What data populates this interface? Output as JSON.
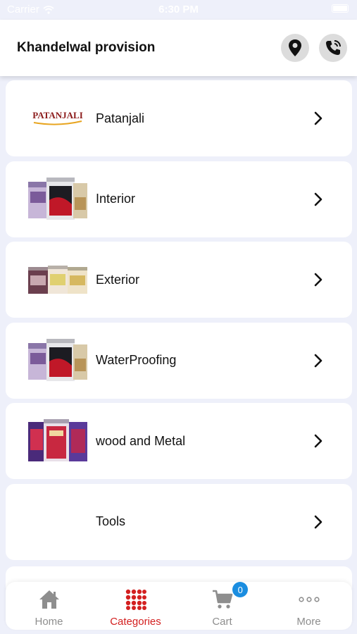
{
  "status_bar": {
    "carrier": "Carrier",
    "time": "6:30 PM"
  },
  "header": {
    "title": "Khandelwal provision",
    "icons": [
      "location-pin-icon",
      "phone-call-icon"
    ]
  },
  "categories": [
    {
      "label": "Patanjali",
      "image": "patanjali-logo",
      "brand_text": "PATANJALI"
    },
    {
      "label": "Interior",
      "image": "interior-paint-cans"
    },
    {
      "label": "Exterior",
      "image": "exterior-paint-cans"
    },
    {
      "label": "WaterProofing",
      "image": "waterproofing-paint-cans"
    },
    {
      "label": "wood and Metal",
      "image": "wood-metal-paint-cans"
    },
    {
      "label": "Tools",
      "image": ""
    }
  ],
  "tabbar": {
    "tabs": [
      {
        "label": "Home",
        "icon": "home-icon",
        "active": false
      },
      {
        "label": "Categories",
        "icon": "grid-dots-icon",
        "active": true
      },
      {
        "label": "Cart",
        "icon": "cart-icon",
        "active": false,
        "badge": "0"
      },
      {
        "label": "More",
        "icon": "more-dots-icon",
        "active": false
      }
    ]
  },
  "colors": {
    "accent": "#d32020",
    "badge": "#1a8de0",
    "background": "#eef0fa"
  }
}
